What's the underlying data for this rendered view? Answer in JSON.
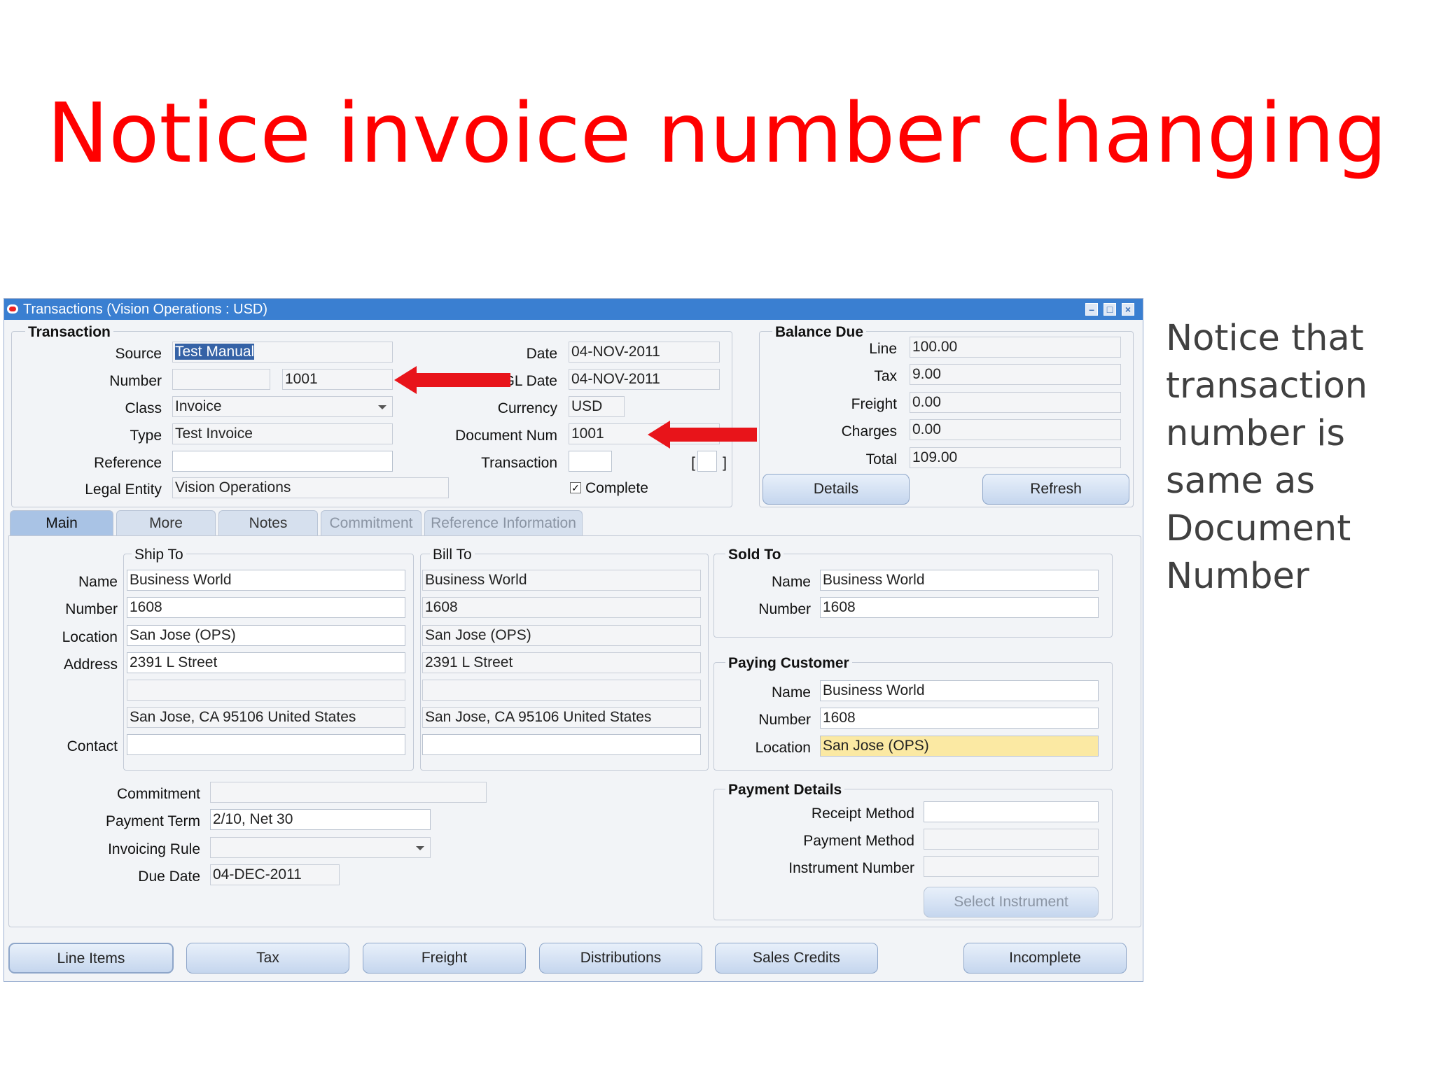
{
  "slide": {
    "title": "Notice invoice number changing",
    "note_lines": [
      "Notice that",
      "transaction",
      "number is",
      "same as",
      "Document",
      "Number"
    ]
  },
  "window": {
    "title": "Transactions (Vision Operations : USD)",
    "controls": [
      "minimize-icon",
      "maximize-icon",
      "close-icon"
    ]
  },
  "transaction": {
    "group_title": "Transaction",
    "source_label": "Source",
    "source_value": "Test Manual",
    "number_label": "Number",
    "number_value": "1001",
    "class_label": "Class",
    "class_value": "Invoice",
    "type_label": "Type",
    "type_value": "Test Invoice",
    "reference_label": "Reference",
    "reference_value": "",
    "legal_entity_label": "Legal Entity",
    "legal_entity_value": "Vision Operations",
    "date_label": "Date",
    "date_value": "04-NOV-2011",
    "gl_date_label": "GL Date",
    "gl_date_value": "04-NOV-2011",
    "currency_label": "Currency",
    "currency_value": "USD",
    "document_num_label": "Document Num",
    "document_num_value": "1001",
    "transaction_label": "Transaction",
    "transaction_value": "",
    "bracket_open": "[",
    "bracket_close": "]",
    "complete_label": "Complete",
    "complete_checked": true
  },
  "balance_due": {
    "group_title": "Balance Due",
    "line_label": "Line",
    "line_value": "100.00",
    "tax_label": "Tax",
    "tax_value": "9.00",
    "freight_label": "Freight",
    "freight_value": "0.00",
    "charges_label": "Charges",
    "charges_value": "0.00",
    "total_label": "Total",
    "total_value": "109.00",
    "details_button": "Details",
    "refresh_button": "Refresh"
  },
  "tabs": [
    "Main",
    "More",
    "Notes",
    "Commitment",
    "Reference Information"
  ],
  "ship_to": {
    "group_title": "Ship To",
    "name_label": "Name",
    "name_value": "Business World",
    "number_label": "Number",
    "number_value": "1608",
    "location_label": "Location",
    "location_value": "San Jose (OPS)",
    "address_label": "Address",
    "address_line1": "2391 L Street",
    "address_line2": "",
    "address_line3": "San Jose, CA 95106 United States",
    "contact_label": "Contact",
    "contact_value": ""
  },
  "bill_to": {
    "group_title": "Bill To",
    "name_value": "Business World",
    "number_value": "1608",
    "location_value": "San Jose (OPS)",
    "address_line1": "2391 L Street",
    "address_line2": "",
    "address_line3": "San Jose, CA 95106 United States",
    "contact_value": ""
  },
  "sold_to": {
    "group_title": "Sold To",
    "name_label": "Name",
    "name_value": "Business World",
    "number_label": "Number",
    "number_value": "1608"
  },
  "paying_customer": {
    "group_title": "Paying Customer",
    "name_label": "Name",
    "name_value": "Business World",
    "number_label": "Number",
    "number_value": "1608",
    "location_label": "Location",
    "location_value": "San Jose (OPS)"
  },
  "terms": {
    "commitment_label": "Commitment",
    "commitment_value": "",
    "payment_term_label": "Payment Term",
    "payment_term_value": "2/10, Net 30",
    "invoicing_rule_label": "Invoicing Rule",
    "invoicing_rule_value": "",
    "due_date_label": "Due Date",
    "due_date_value": "04-DEC-2011"
  },
  "payment_details": {
    "group_title": "Payment Details",
    "receipt_method_label": "Receipt Method",
    "receipt_method_value": "",
    "payment_method_label": "Payment Method",
    "payment_method_value": "",
    "instrument_number_label": "Instrument Number",
    "instrument_number_value": "",
    "select_instrument_button": "Select Instrument"
  },
  "bottom_buttons": {
    "line_items": "Line Items",
    "tax": "Tax",
    "freight": "Freight",
    "distributions": "Distributions",
    "sales_credits": "Sales Credits",
    "incomplete": "Incomplete"
  },
  "colors": {
    "title_red": "#ff0000",
    "arrow_red": "#e8141a",
    "titlebar_blue": "#3a7fd1",
    "highlight_yellow": "#fbe9a3"
  }
}
